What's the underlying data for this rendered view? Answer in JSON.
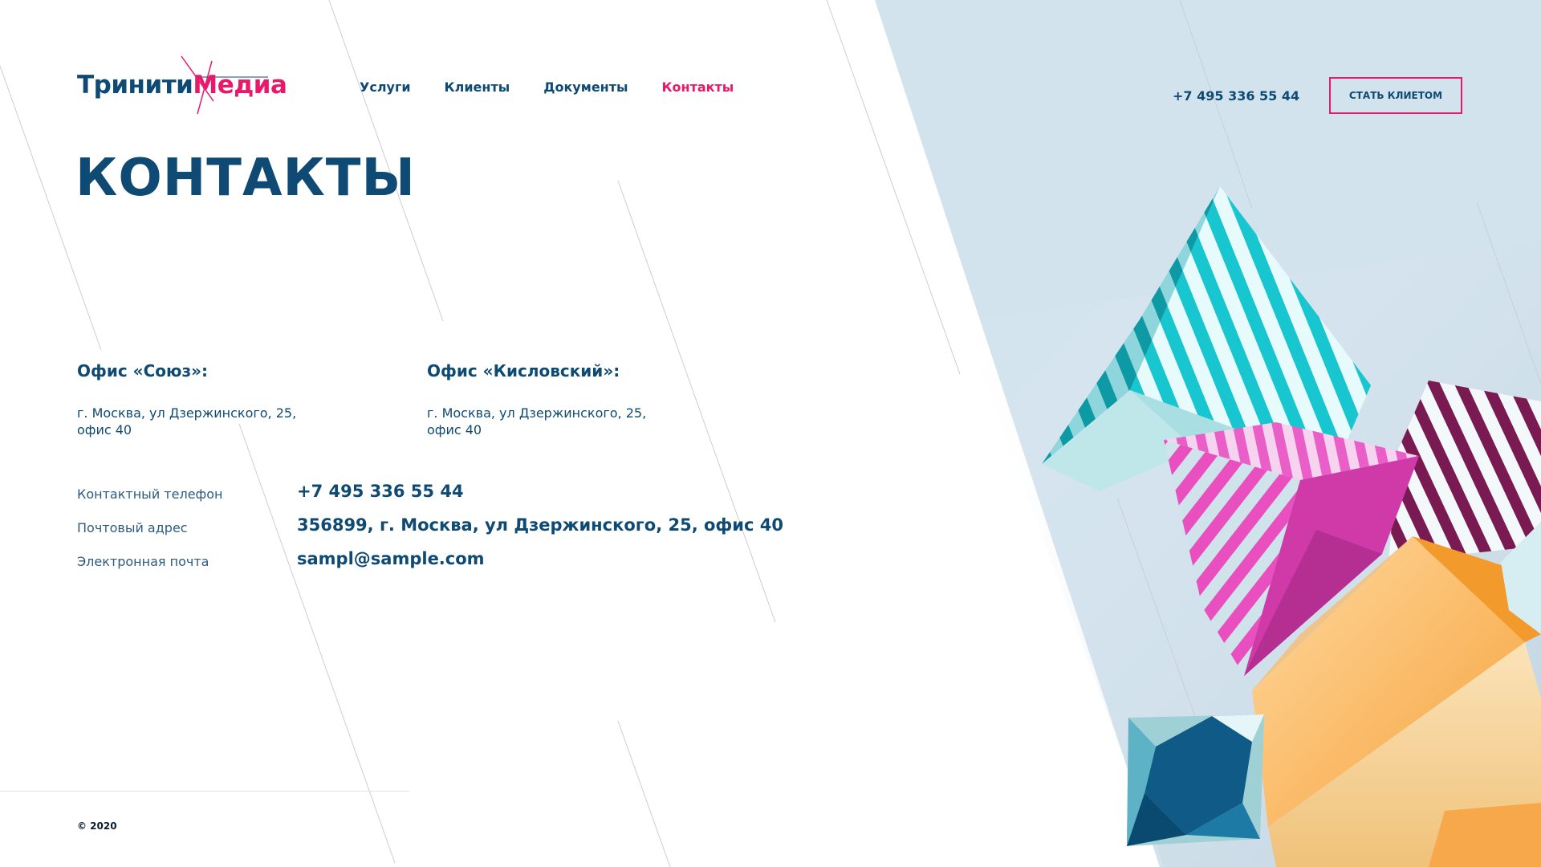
{
  "brand": {
    "name_part1": "Тринити",
    "name_part2": "Медиа",
    "color_primary": "#0e4a73",
    "color_accent": "#e8196a",
    "color_panel": "#d3e3ee"
  },
  "nav": {
    "items": [
      {
        "label": "Услуги",
        "active": false
      },
      {
        "label": "Клиенты",
        "active": false
      },
      {
        "label": "Документы",
        "active": false
      },
      {
        "label": "Контакты",
        "active": true
      }
    ]
  },
  "header": {
    "phone": "+7 495 336 55 44",
    "cta_label": "Стать клиетом"
  },
  "page": {
    "title": "КОНТАКТЫ"
  },
  "offices": [
    {
      "title": "Офис «Союз»:",
      "address_line1": "г. Москва, ул Дзержинского, 25,",
      "address_line2": "офис 40"
    },
    {
      "title": "Офис «Кисловский»:",
      "address_line1": "г. Москва, ул Дзержинского, 25,",
      "address_line2": "офис 40"
    }
  ],
  "contacts": [
    {
      "label": "Контактный телефон",
      "value": "+7 495 336 55 44"
    },
    {
      "label": "Почтовый адрес",
      "value": "356899, г. Москва, ул Дзержинского, 25, офис 40"
    },
    {
      "label": "Электронная почта",
      "value": "sampl@sample.com"
    }
  ],
  "footer": {
    "copyright": "© 2020"
  },
  "decoration": {
    "illustration": "geometric-3d-shapes-illustration",
    "shape_colors": [
      "#1fc3cc",
      "#e94fbf",
      "#f6a23a",
      "#0f5a86",
      "#7a1a52"
    ]
  }
}
